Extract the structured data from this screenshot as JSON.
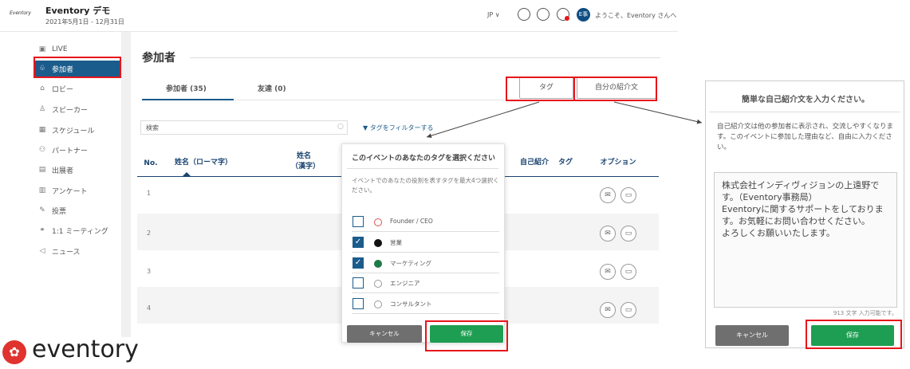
{
  "header": {
    "logo_small": "Eventory",
    "app_title": "Eventory デモ",
    "dates": "2021年5月1日 - 12月31日",
    "language": "JP ∨",
    "avatar": "E事",
    "welcome": "ようこそ、Eventory さんへ"
  },
  "sidebar": {
    "items": [
      {
        "label": "LIVE",
        "icon": "live-icon",
        "glyph": "▣"
      },
      {
        "label": "参加者",
        "icon": "participants-icon",
        "glyph": "♧"
      },
      {
        "label": "ロビー",
        "icon": "home-icon",
        "glyph": "⌂"
      },
      {
        "label": "スピーカー",
        "icon": "speaker-icon",
        "glyph": "♙"
      },
      {
        "label": "スケジュール",
        "icon": "calendar-icon",
        "glyph": "▦"
      },
      {
        "label": "パートナー",
        "icon": "partner-icon",
        "glyph": "⚇"
      },
      {
        "label": "出展者",
        "icon": "exhibitor-icon",
        "glyph": "▤"
      },
      {
        "label": "アンケート",
        "icon": "survey-icon",
        "glyph": "▥"
      },
      {
        "label": "投票",
        "icon": "vote-icon",
        "glyph": "✎"
      },
      {
        "label": "1:1 ミーティング",
        "icon": "meeting-icon",
        "glyph": "⚭"
      },
      {
        "label": "ニュース",
        "icon": "news-icon",
        "glyph": "◁"
      }
    ]
  },
  "main": {
    "title": "参加者",
    "tabs": [
      {
        "label": "参加者 (35)"
      },
      {
        "label": "友達 (0)"
      }
    ],
    "tag_button": "タグ",
    "intro_button": "自分の紹介文",
    "search_text": "検索",
    "filter_label": "タグをフィルターする",
    "columns": [
      "No.",
      "姓名（ローマ字）",
      "姓名（漢字）",
      "自己紹介",
      "タグ",
      "オプション"
    ],
    "rows": [
      "1",
      "2",
      "3",
      "4"
    ]
  },
  "tag_popover": {
    "title": "このイベントのあなたのタグを選択ください",
    "description": "イベントでのあなたの役割を表すタグを最大4つ選択ください。",
    "options": [
      {
        "label": "Founder / CEO",
        "checked": false,
        "dot_color": "#ffffff",
        "dot_border": "#d9534f"
      },
      {
        "label": "営業",
        "checked": true,
        "dot_color": "#111111",
        "dot_border": "#111111"
      },
      {
        "label": "マーケティング",
        "checked": true,
        "dot_color": "#1e7a47",
        "dot_border": "#1e7a47"
      },
      {
        "label": "エンジニア",
        "checked": false,
        "dot_color": "#ffffff",
        "dot_border": "#999999"
      },
      {
        "label": "コンサルタント",
        "checked": false,
        "dot_color": "#ffffff",
        "dot_border": "#999999"
      }
    ],
    "cancel": "キャンセル",
    "save": "保存"
  },
  "intro_panel": {
    "title": "簡単な自己紹介文を入力ください。",
    "description": "自己紹介文は他の参加者に表示され、交流しやすくなります。このイベントに参加した理由など、自由に入力ください。",
    "text": "株式会社インディヴィジョンの上遠野です。（Eventory事務局）\nEventoryに関するサポートをしております。お気軽にお問い合わせください。\nよろしくお願いいたします。",
    "char_count": "913 文字 入力可能です。",
    "cancel": "キャンセル",
    "save": "保存"
  },
  "brand": {
    "name": "eventory"
  },
  "colors": {
    "accent": "#1a5c8c",
    "highlight": "#e8151b",
    "save_green": "#1e9e52",
    "brand_red": "#e0322e"
  }
}
